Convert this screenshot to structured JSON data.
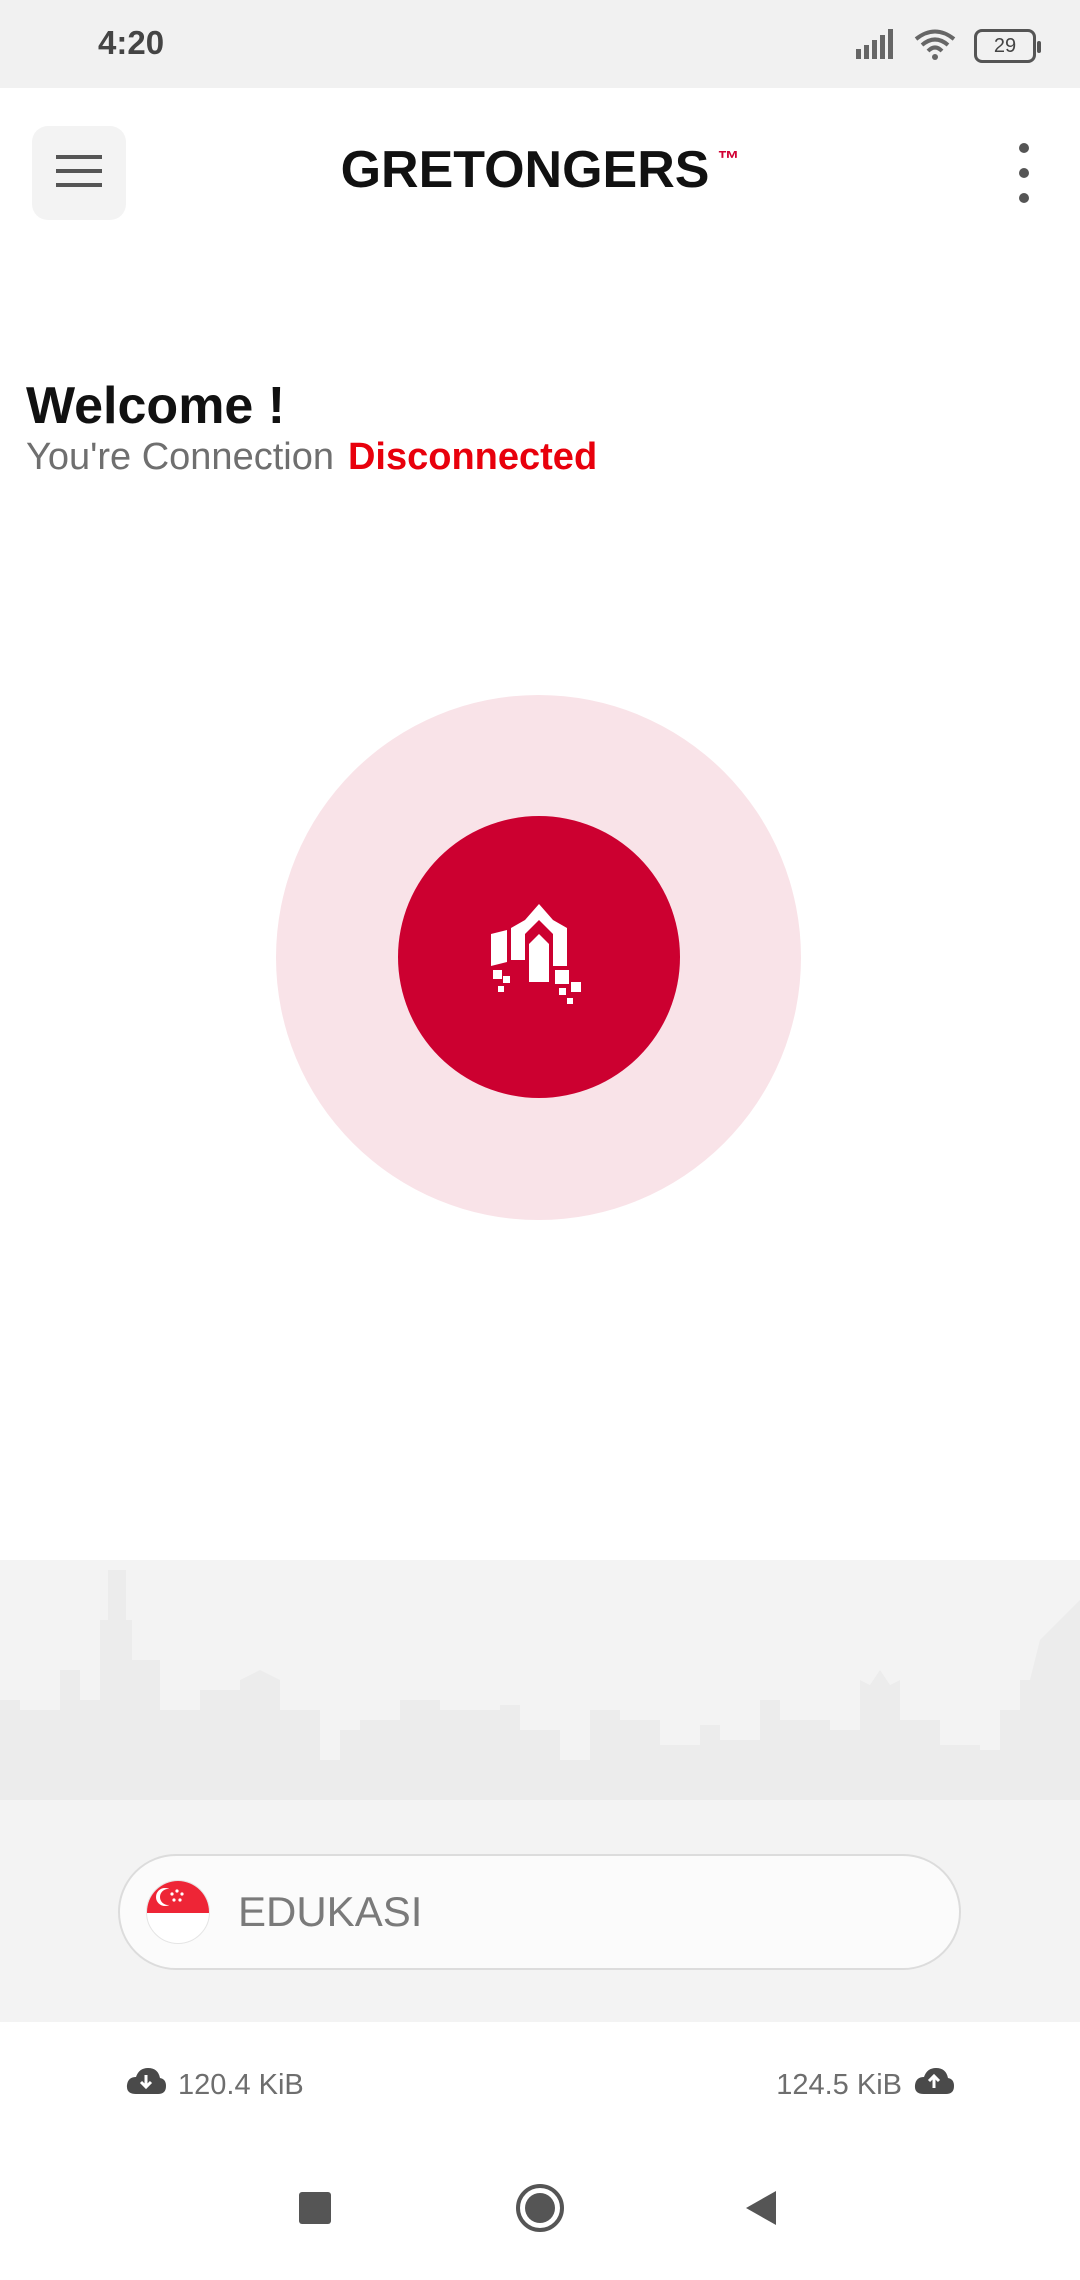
{
  "status_bar": {
    "time": "4:20",
    "battery": "29",
    "icons": [
      "signal-icon",
      "wifi-icon",
      "battery-icon"
    ]
  },
  "header": {
    "title": "GRETONGERS",
    "trademark": "™",
    "menu_icon": "menu-icon",
    "more_icon": "more-vertical-icon"
  },
  "welcome": {
    "title": "Welcome !",
    "connection_prefix": "You're Connection",
    "status": "Disconnected"
  },
  "connect_button": {
    "icon": "app-logo-icon"
  },
  "server": {
    "name": "EDUKASI",
    "flag": "singapore-flag"
  },
  "traffic": {
    "download": "120.4 KiB",
    "upload": "124.5 KiB"
  },
  "colors": {
    "accent": "#cc0030",
    "status_disconnected": "#e8000c",
    "pulse": "#f9e3e8"
  },
  "nav": {
    "buttons": [
      "recents-button",
      "home-button",
      "back-button"
    ]
  }
}
